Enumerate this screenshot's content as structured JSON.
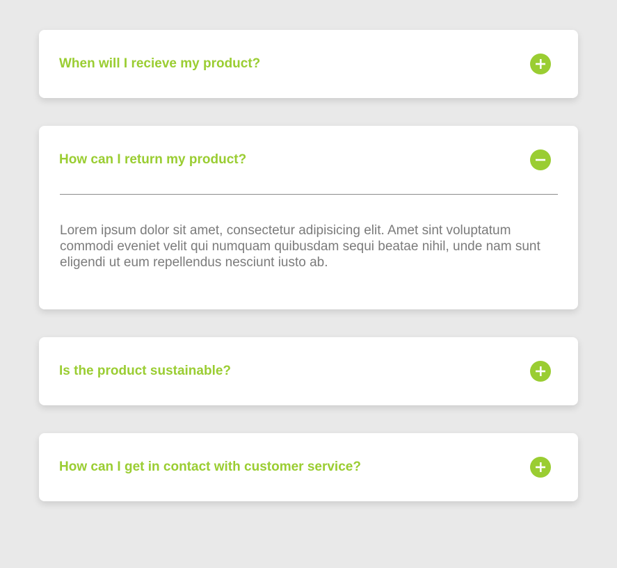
{
  "faq": {
    "items": [
      {
        "question": "When will I recieve my product?",
        "expanded": false,
        "toggle_icon": "plus-icon"
      },
      {
        "question": "How can I return my product?",
        "expanded": true,
        "toggle_icon": "minus-icon",
        "answer": "Lorem ipsum dolor sit amet, consectetur adipisicing elit. Amet sint voluptatum commodi eveniet velit qui numquam quibusdam sequi beatae nihil, unde nam sunt eligendi ut eum repellendus nesciunt iusto ab."
      },
      {
        "question": "Is the product sustainable?",
        "expanded": false,
        "toggle_icon": "plus-icon"
      },
      {
        "question": "How can I get in contact with customer service?",
        "expanded": false,
        "toggle_icon": "plus-icon"
      }
    ]
  },
  "colors": {
    "accent": "#9acd32",
    "background": "#e9e9e9",
    "card": "#ffffff",
    "answer_text": "#7b7b7b",
    "divider": "#8a8a8a"
  }
}
